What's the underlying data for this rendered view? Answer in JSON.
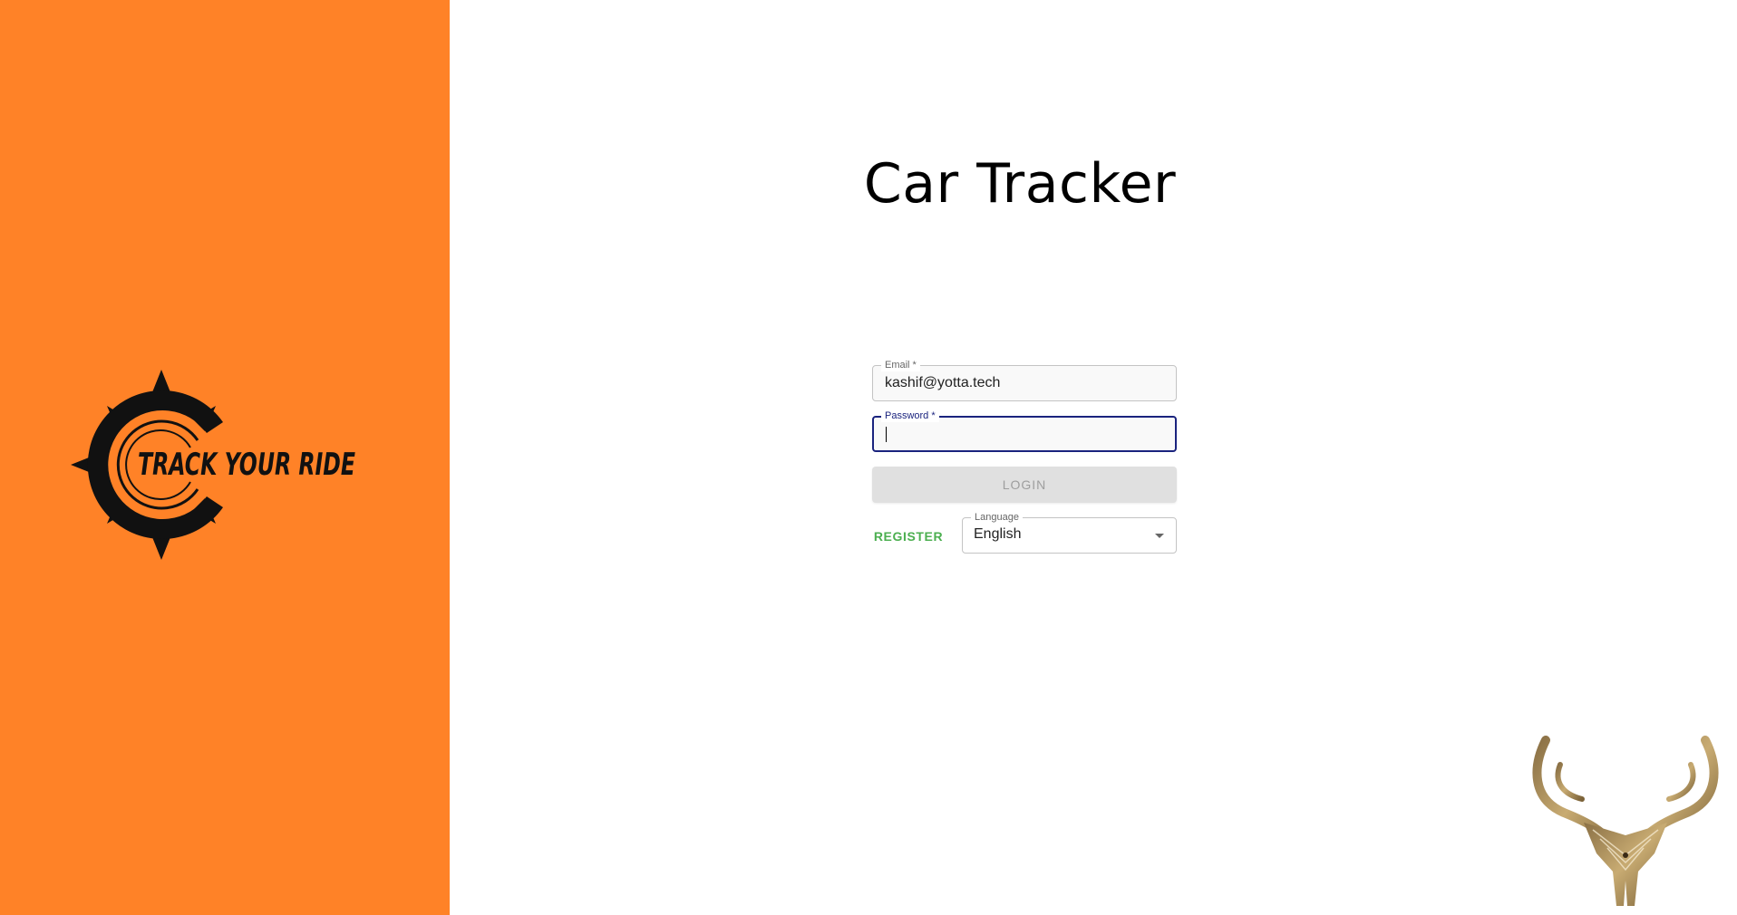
{
  "app": {
    "title": "Car Tracker",
    "brand_logo_text": "TRACK YOUR RIDE"
  },
  "form": {
    "email": {
      "label": "Email *",
      "value": "kashif@yotta.tech"
    },
    "password": {
      "label": "Password *",
      "value": ""
    },
    "login_label": "LOGIN",
    "register_label": "REGISTER",
    "language": {
      "label": "Language",
      "selected": "English"
    }
  },
  "colors": {
    "brand_orange": "#ff8227",
    "focus_border": "#1a237e",
    "register_green": "#4caf50",
    "disabled_button": "#e0e0e0"
  },
  "icons": {
    "brand_logo": "track-your-ride-logo",
    "corner_logo": "antler-emblem-logo",
    "dropdown": "chevron-down-icon"
  }
}
